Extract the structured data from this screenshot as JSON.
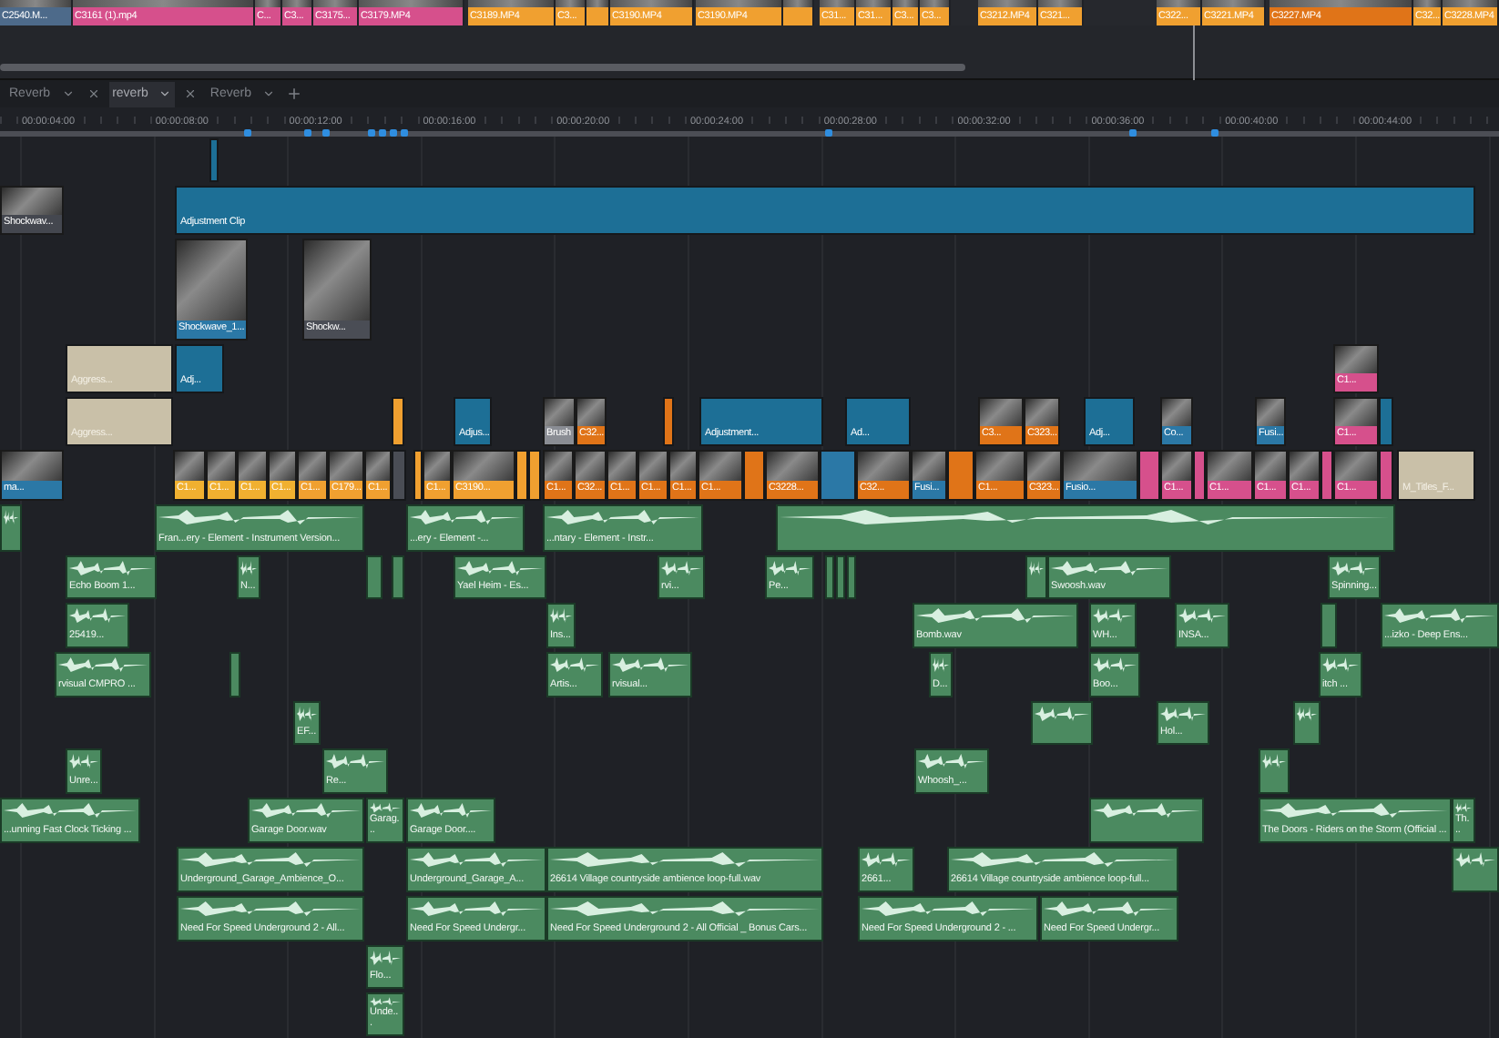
{
  "source_strip": {
    "clips": [
      {
        "label": "C2540.M...",
        "color": "#4d6a8a"
      },
      {
        "label": "C3161 (1).mp4",
        "color": "#d6508c"
      },
      {
        "label": "C...",
        "color": "#d6508c"
      },
      {
        "label": "C3...",
        "color": "#d6508c"
      },
      {
        "label": "C3175...",
        "color": "#d6508c"
      },
      {
        "label": "C3179.MP4",
        "color": "#d6508c"
      },
      {
        "label": "C3189.MP4",
        "color": "#f0a030"
      },
      {
        "label": "C3...",
        "color": "#f0a030"
      },
      {
        "color": "#f0a030"
      },
      {
        "label": "C3190.MP4",
        "color": "#f0a030"
      },
      {
        "label": "C3190.MP4",
        "color": "#f0a030"
      },
      {
        "color": "#f0a030"
      },
      {
        "label": "C31...",
        "color": "#f0a030"
      },
      {
        "label": "C31...",
        "color": "#f0a030"
      },
      {
        "label": "C3...",
        "color": "#f0a030"
      },
      {
        "label": "C3...",
        "color": "#f0a030"
      },
      {
        "label": "C3212.MP4",
        "color": "#f0a030"
      },
      {
        "label": "C321...",
        "color": "#f0a030"
      },
      {
        "label": "C322...",
        "color": "#f0a030"
      },
      {
        "label": "C3221.MP4",
        "color": "#f0a030"
      },
      {
        "label": "C3227.MP4",
        "color": "#e07418"
      },
      {
        "label": "C32...",
        "color": "#f0a030"
      },
      {
        "label": "C3228.MP4",
        "color": "#f0a030"
      }
    ]
  },
  "tabs": [
    {
      "label": "Reverb",
      "selected": false
    },
    {
      "label": "reverb",
      "selected": true
    },
    {
      "label": "Reverb",
      "selected": false
    }
  ],
  "ruler": {
    "timecodes": [
      "00:00:04:00",
      "00:00:08:00",
      "00:00:12:00",
      "00:00:16:00",
      "00:00:20:00",
      "00:00:24:00",
      "00:00:28:00",
      "00:00:32:00",
      "00:00:36:00",
      "00:00:40:00",
      "00:00:44:00"
    ]
  },
  "video_tracks": [
    {
      "clips": [
        {
          "kind": "adjustment",
          "color": "#1d6f96"
        }
      ]
    },
    {
      "clips": [
        {
          "kind": "clip",
          "label": "Shockwav...",
          "color": "#44474f"
        },
        {
          "kind": "adjustment",
          "label": "Adjustment Clip",
          "color": "#1d6f96"
        }
      ]
    },
    {
      "clips": [
        {
          "kind": "clip",
          "label": "Shockwave_1...",
          "color": "#2b78a6"
        },
        {
          "kind": "clip",
          "label": "Shockw...",
          "color": "#4a4d55"
        }
      ]
    },
    {
      "clips": [
        {
          "kind": "title",
          "label": "Aggress...",
          "color": "#c9c0a8"
        },
        {
          "kind": "adjustment",
          "label": "Adj...",
          "color": "#1d6f96"
        },
        {
          "kind": "clip",
          "label": "C1...",
          "color": "#d6508c"
        }
      ]
    },
    {
      "clips": [
        {
          "kind": "title",
          "label": "Aggress...",
          "color": "#c9c0a8"
        },
        {
          "kind": "adjustment",
          "color": "#f0a030"
        },
        {
          "kind": "adjustment",
          "label": "Adjus...",
          "color": "#1d6f96"
        },
        {
          "kind": "clip",
          "label": "Brush",
          "color": "#8a8d94"
        },
        {
          "kind": "clip",
          "label": "C32...",
          "color": "#e07418"
        },
        {
          "kind": "adjustment",
          "color": "#e07418"
        },
        {
          "kind": "adjustment",
          "label": "Adjustment...",
          "color": "#1d6f96"
        },
        {
          "kind": "adjustment",
          "label": "Ad...",
          "color": "#1d6f96"
        },
        {
          "kind": "clip",
          "label": "C3...",
          "color": "#e07418"
        },
        {
          "kind": "clip",
          "label": "C323...",
          "color": "#e07418"
        },
        {
          "kind": "adjustment",
          "label": "Adj...",
          "color": "#1d6f96"
        },
        {
          "kind": "clip",
          "label": "Co...",
          "color": "#2b78a6"
        },
        {
          "kind": "clip",
          "label": "Fusi...",
          "color": "#2b78a6"
        },
        {
          "kind": "clip",
          "label": "C1...",
          "color": "#d6508c"
        },
        {
          "kind": "adjustment",
          "color": "#1d6f96"
        }
      ]
    },
    {
      "clips": [
        {
          "kind": "clip",
          "label": "ma...",
          "color": "#2b78a6"
        },
        {
          "kind": "clip",
          "label": "C1...",
          "color": "#f0b030"
        },
        {
          "kind": "clip",
          "label": "C1...",
          "color": "#f0b030"
        },
        {
          "kind": "clip",
          "label": "C1...",
          "color": "#f0b030"
        },
        {
          "kind": "clip",
          "label": "C1...",
          "color": "#f0b030"
        },
        {
          "kind": "clip",
          "label": "C1...",
          "color": "#f0a030"
        },
        {
          "kind": "clip",
          "label": "C179...",
          "color": "#f0a030"
        },
        {
          "kind": "clip",
          "label": "C1...",
          "color": "#f0a030"
        },
        {
          "kind": "adjustment",
          "color": "#4a4d55"
        },
        {
          "kind": "adjustment",
          "color": "#f0a030"
        },
        {
          "kind": "clip",
          "label": "C1...",
          "color": "#f0a030"
        },
        {
          "kind": "clip",
          "label": "C3190...",
          "color": "#f0a030"
        },
        {
          "kind": "adjustment",
          "color": "#f0a030"
        },
        {
          "kind": "adjustment",
          "color": "#f0a030"
        },
        {
          "kind": "clip",
          "label": "C1...",
          "color": "#e07418"
        },
        {
          "kind": "clip",
          "label": "C32...",
          "color": "#e07418"
        },
        {
          "kind": "clip",
          "label": "C1...",
          "color": "#e07418"
        },
        {
          "kind": "clip",
          "label": "C1...",
          "color": "#e07418"
        },
        {
          "kind": "clip",
          "label": "C1...",
          "color": "#e07418"
        },
        {
          "kind": "clip",
          "label": "C1...",
          "color": "#e07418"
        },
        {
          "kind": "adjustment",
          "color": "#e07418"
        },
        {
          "kind": "clip",
          "label": "C3228...",
          "color": "#e07418"
        },
        {
          "kind": "adjustment",
          "color": "#2b78a6"
        },
        {
          "kind": "clip",
          "label": "C32...",
          "color": "#e07418"
        },
        {
          "kind": "clip",
          "label": "Fusi...",
          "color": "#2b78a6"
        },
        {
          "kind": "adjustment",
          "color": "#e07418"
        },
        {
          "kind": "clip",
          "label": "C1...",
          "color": "#e07418"
        },
        {
          "kind": "clip",
          "label": "C323...",
          "color": "#e07418"
        },
        {
          "kind": "clip",
          "label": "Fusio...",
          "color": "#2b78a6"
        },
        {
          "kind": "adjustment",
          "color": "#d6508c"
        },
        {
          "kind": "clip",
          "label": "C1...",
          "color": "#d6508c"
        },
        {
          "kind": "adjustment",
          "color": "#d6508c"
        },
        {
          "kind": "clip",
          "label": "C1...",
          "color": "#d6508c"
        },
        {
          "kind": "clip",
          "label": "C1...",
          "color": "#d6508c"
        },
        {
          "kind": "clip",
          "label": "C1...",
          "color": "#d6508c"
        },
        {
          "kind": "adjustment",
          "color": "#d6508c"
        },
        {
          "kind": "clip",
          "label": "C1...",
          "color": "#d6508c"
        },
        {
          "kind": "adjustment",
          "color": "#d6508c"
        },
        {
          "kind": "title",
          "label": "M_Titles_F...",
          "color": "#c9c0a8"
        }
      ]
    }
  ],
  "audio_tracks": [
    {
      "clips": [
        {
          "kind": "clip"
        },
        {
          "kind": "clip",
          "label": "Fran...ery - Element - Instrument Version..."
        },
        {
          "kind": "clip",
          "label": "...ery - Element -..."
        },
        {
          "kind": "clip",
          "label": "...ntary - Element - Instr..."
        },
        {
          "kind": "clip"
        }
      ]
    },
    {
      "clips": [
        {
          "kind": "clip",
          "label": "Echo Boom 1..."
        },
        {
          "kind": "clip",
          "label": "N..."
        },
        {
          "kind": "clip"
        },
        {
          "kind": "clip"
        },
        {
          "kind": "clip",
          "label": "Yael Heim - Es..."
        },
        {
          "kind": "clip",
          "label": "rvi..."
        },
        {
          "kind": "clip",
          "label": "Pe..."
        },
        {
          "kind": "clip"
        },
        {
          "kind": "clip"
        },
        {
          "kind": "clip"
        },
        {
          "kind": "clip"
        },
        {
          "kind": "clip",
          "label": "Swoosh.wav"
        },
        {
          "kind": "clip",
          "label": "Spinning..."
        }
      ]
    },
    {
      "clips": [
        {
          "kind": "clip",
          "label": "25419..."
        },
        {
          "kind": "clip",
          "label": "Ins..."
        },
        {
          "kind": "clip",
          "label": "Bomb.wav"
        },
        {
          "kind": "clip",
          "label": "WH..."
        },
        {
          "kind": "clip",
          "label": "INSA..."
        },
        {
          "kind": "clip"
        },
        {
          "kind": "clip",
          "label": "...izko - Deep Ens..."
        }
      ]
    },
    {
      "clips": [
        {
          "kind": "clip",
          "label": "rvisual CMPRO ..."
        },
        {
          "kind": "clip"
        },
        {
          "kind": "clip",
          "label": "Artis..."
        },
        {
          "kind": "clip",
          "label": "rvisual..."
        },
        {
          "kind": "clip",
          "label": "D..."
        },
        {
          "kind": "clip",
          "label": "Boo..."
        },
        {
          "kind": "clip",
          "label": "itch ..."
        }
      ]
    },
    {
      "clips": [
        {
          "kind": "clip",
          "label": "EF..."
        },
        {
          "kind": "clip"
        },
        {
          "kind": "clip",
          "label": "Hol..."
        },
        {
          "kind": "clip"
        }
      ]
    },
    {
      "clips": [
        {
          "kind": "clip",
          "label": "Unre..."
        },
        {
          "kind": "clip",
          "label": "Re..."
        },
        {
          "kind": "clip",
          "label": "Whoosh_..."
        },
        {
          "kind": "clip"
        }
      ]
    },
    {
      "clips": [
        {
          "kind": "clip",
          "label": "...unning Fast Clock Ticking ..."
        },
        {
          "kind": "clip",
          "label": "Garage Door.wav"
        },
        {
          "kind": "clip",
          "label": "Garag..."
        },
        {
          "kind": "clip",
          "label": "Garage Door...."
        },
        {
          "kind": "clip"
        },
        {
          "kind": "clip",
          "label": "The Doors - Riders on the Storm (Official ..."
        },
        {
          "kind": "clip",
          "label": "Th..."
        }
      ]
    },
    {
      "clips": [
        {
          "kind": "clip",
          "label": "Underground_Garage_Ambience_O..."
        },
        {
          "kind": "clip",
          "label": "Underground_Garage_A..."
        },
        {
          "kind": "clip",
          "label": "26614 Village countryside ambience loop-full.wav"
        },
        {
          "kind": "clip",
          "label": "2661..."
        },
        {
          "kind": "clip",
          "label": "26614 Village countryside ambience loop-full..."
        },
        {
          "kind": "clip"
        }
      ]
    },
    {
      "clips": [
        {
          "kind": "clip",
          "label": "Need For Speed Underground 2 - All..."
        },
        {
          "kind": "clip",
          "label": "Need For Speed Undergr..."
        },
        {
          "kind": "clip",
          "label": "Need For Speed Underground 2 - All Official _ Bonus Cars..."
        },
        {
          "kind": "clip",
          "label": "Need For Speed Underground 2 - ..."
        },
        {
          "kind": "clip",
          "label": "Need For Speed Undergr..."
        }
      ]
    },
    {
      "clips": [
        {
          "kind": "clip",
          "label": "Flo..."
        }
      ]
    },
    {
      "clips": [
        {
          "kind": "clip",
          "label": "Unde..."
        }
      ]
    }
  ]
}
